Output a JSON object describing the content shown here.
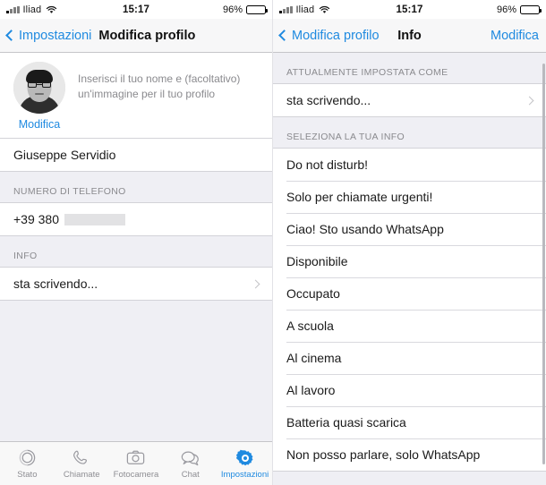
{
  "status_bar": {
    "carrier": "Iliad",
    "time": "15:17",
    "battery_pct": "96%",
    "wifi_icon": "wifi-icon",
    "signal_icon": "signal-bars-icon",
    "battery_icon": "battery-icon"
  },
  "left_screen": {
    "nav": {
      "back_label": "Impostazioni",
      "title": "Modifica profilo",
      "back_icon": "chevron-left-icon"
    },
    "profile": {
      "hint_line1": "Inserisci il tuo nome e (facoltativo)",
      "hint_line2": "un'immagine per il tuo profilo",
      "edit_label": "Modifica",
      "avatar_icon": "profile-avatar-image",
      "name": "Giuseppe Servidio"
    },
    "phone_section": {
      "header": "NUMERO DI TELEFONO",
      "value": "+39 380"
    },
    "info_section": {
      "header": "INFO",
      "value": "sta scrivendo...",
      "chevron_icon": "chevron-right-icon"
    },
    "tabbar": [
      {
        "label": "Stato",
        "icon": "status-rings-icon",
        "active": false
      },
      {
        "label": "Chiamate",
        "icon": "phone-handset-icon",
        "active": false
      },
      {
        "label": "Fotocamera",
        "icon": "camera-icon",
        "active": false
      },
      {
        "label": "Chat",
        "icon": "chat-bubbles-icon",
        "active": false
      },
      {
        "label": "Impostazioni",
        "icon": "gear-icon",
        "active": true
      }
    ]
  },
  "right_screen": {
    "nav": {
      "back_label": "Modifica profilo",
      "title": "Info",
      "action_label": "Modifica",
      "back_icon": "chevron-left-icon"
    },
    "current_section": {
      "header": "ATTUALMENTE IMPOSTATA COME",
      "value": "sta scrivendo...",
      "chevron_icon": "chevron-right-icon"
    },
    "choose_section": {
      "header": "SELEZIONA LA TUA INFO",
      "options": [
        "Do not disturb!",
        "Solo per chiamate urgenti!",
        "Ciao! Sto usando WhatsApp",
        "Disponibile",
        "Occupato",
        "A scuola",
        "Al cinema",
        "Al lavoro",
        "Batteria quasi scarica",
        "Non posso parlare, solo WhatsApp"
      ]
    }
  },
  "colors": {
    "accent": "#1f8ae0",
    "group_bg": "#efeff4",
    "cell_bg": "#ffffff",
    "header_text": "#8a8a8e",
    "nav_bg": "#f7f7f8"
  }
}
